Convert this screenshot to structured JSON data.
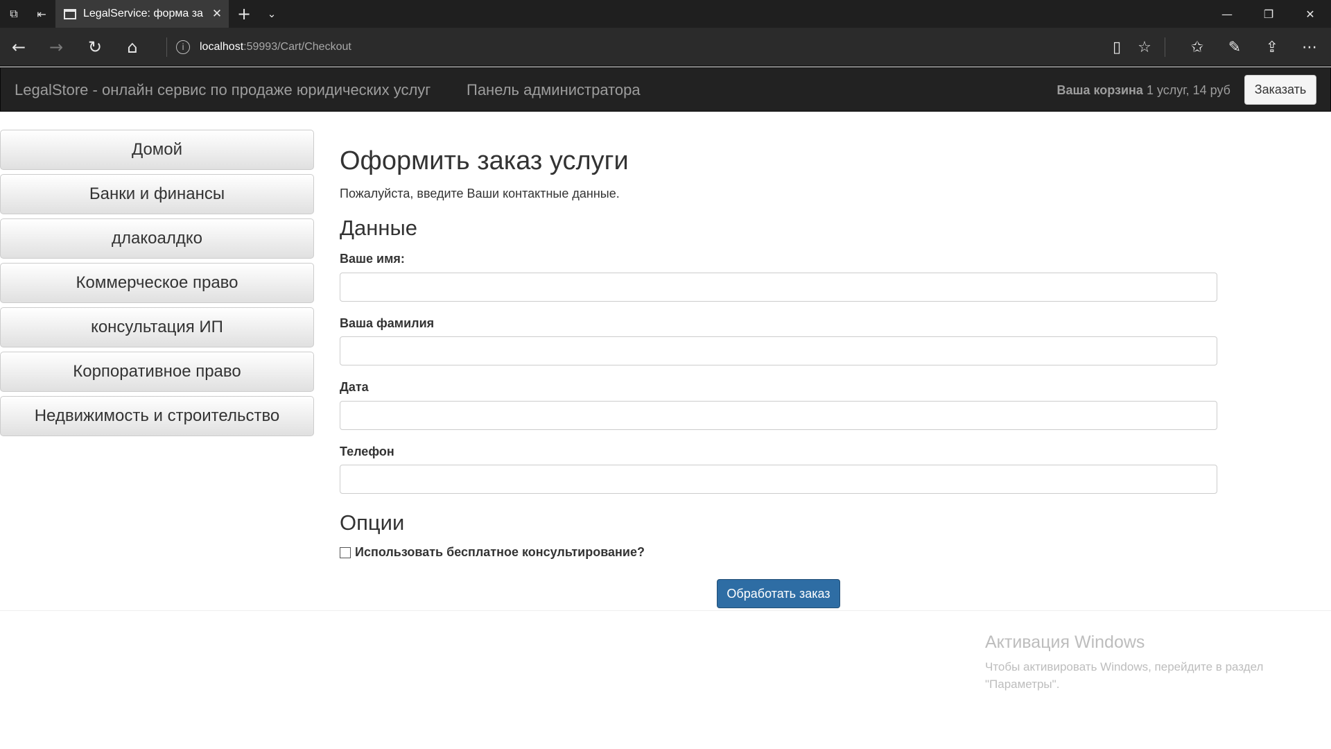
{
  "browser": {
    "tab_title": "LegalService: форма за",
    "url_host": "localhost",
    "url_path": ":59993/Cart/Checkout"
  },
  "site": {
    "brand": "LegalStore - онлайн сервис по продаже юридических услуг",
    "admin_link": "Панель администратора",
    "cart_label": "Ваша корзина",
    "cart_summary": "1 услуг, 14 руб",
    "order_button": "Заказать"
  },
  "sidebar": {
    "categories": [
      "Домой",
      "Банки и финансы",
      "длакоалдко",
      "Коммерческое право",
      "консультация ИП",
      "Корпоративное право",
      "Недвижимость и строительство"
    ]
  },
  "checkout": {
    "title": "Оформить заказ услуги",
    "intro": "Пожалуйста, введите Ваши контактные данные.",
    "data_section": "Данные",
    "fields": {
      "first_name": {
        "label": "Ваше имя:",
        "value": ""
      },
      "last_name": {
        "label": "Ваша фамилия",
        "value": ""
      },
      "date": {
        "label": "Дата",
        "value": ""
      },
      "phone": {
        "label": "Телефон",
        "value": ""
      }
    },
    "options_section": "Опции",
    "free_consult_label": "Использовать бесплатное консультирование?",
    "free_consult_checked": false,
    "submit_label": "Обработать заказ"
  },
  "watermark": {
    "title": "Активация Windows",
    "text": "Чтобы активировать Windows, перейдите в раздел \"Параметры\"."
  },
  "colors": {
    "navbar_bg": "#222222",
    "primary_button": "#2e6da4",
    "browser_chrome": "#2b2b2b"
  }
}
